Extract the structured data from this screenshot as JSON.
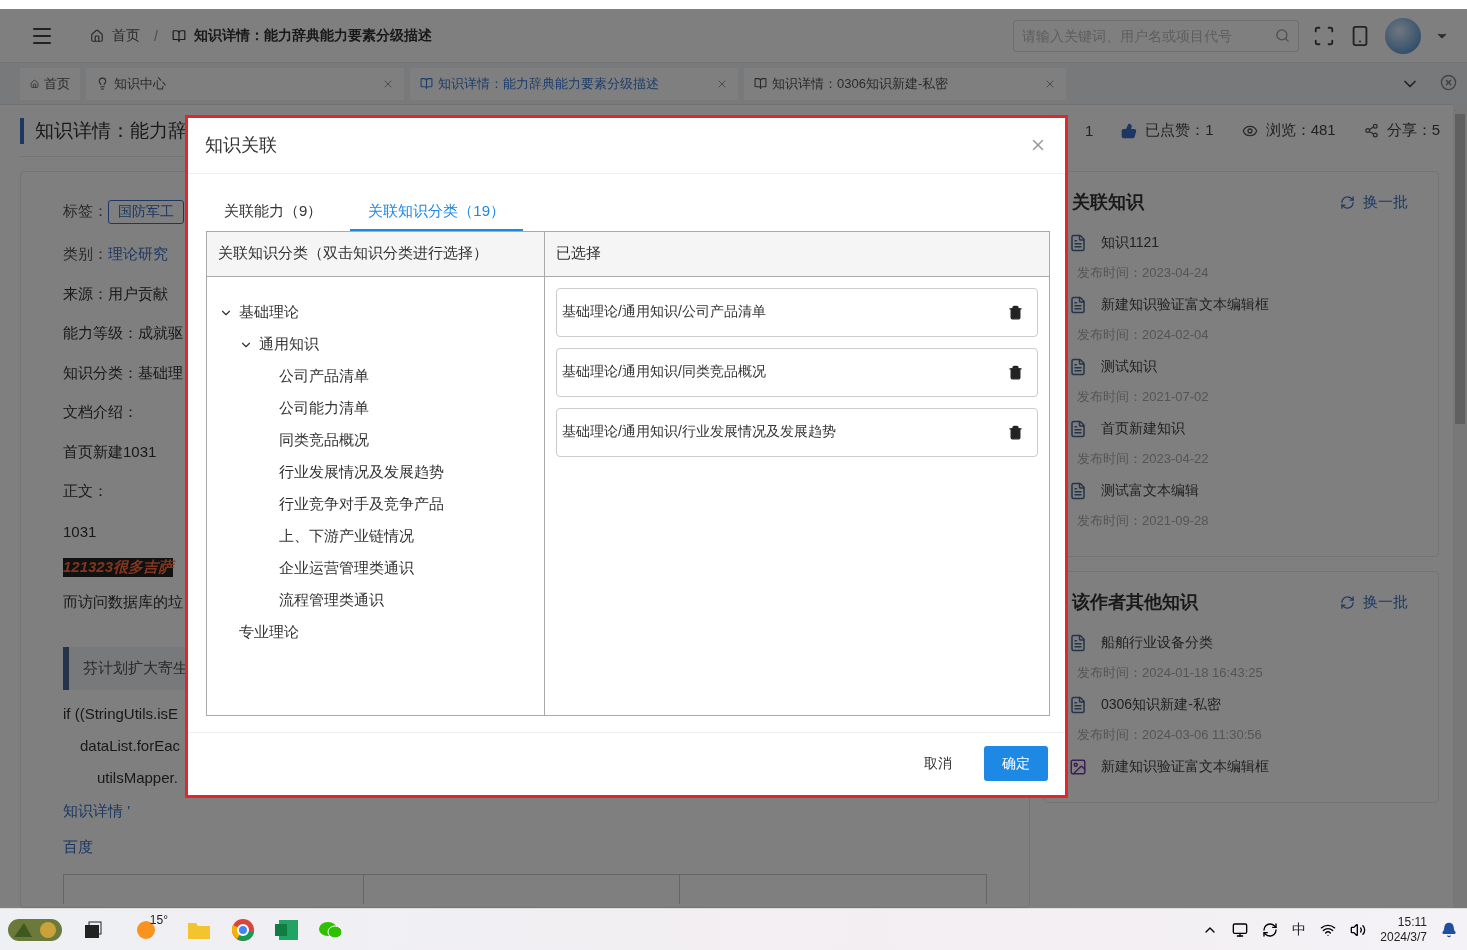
{
  "header": {
    "breadcrumb": [
      {
        "kind": "home",
        "label": "首页"
      },
      {
        "kind": "book",
        "label": "知识详情：能力辞典能力要素分级描述"
      }
    ],
    "separator": "/",
    "search": {
      "placeholder": "请输入关键词、用户名或项目代号"
    }
  },
  "tabs": [
    {
      "kind": "home",
      "label": "首页",
      "selected": false,
      "closable": false
    },
    {
      "kind": "bulb",
      "label": "知识中心",
      "selected": false,
      "closable": true
    },
    {
      "kind": "book",
      "label": "知识详情：能力辞典能力要素分级描述",
      "selected": true,
      "closable": true
    },
    {
      "kind": "book",
      "label": "知识详情：0306知识新建-私密",
      "selected": false,
      "closable": true
    }
  ],
  "page": {
    "title": "知识详情：能力辞",
    "stats": [
      {
        "kind": "count",
        "text": "1"
      },
      {
        "kind": "like",
        "text": "已点赞：1"
      },
      {
        "kind": "view",
        "text": "浏览：481"
      },
      {
        "kind": "share",
        "text": "分享：5"
      }
    ],
    "rows": [
      {
        "kind": "tags",
        "label": "标签：",
        "tags": [
          "国防军工"
        ]
      },
      {
        "kind": "link",
        "label": "类别：",
        "value": "理论研究"
      },
      {
        "kind": "text",
        "text": "来源：用户贡献"
      },
      {
        "kind": "text",
        "text": "能力等级：成就驱"
      },
      {
        "kind": "text",
        "text": "知识分类：基础理"
      },
      {
        "kind": "text",
        "text": "文档介绍："
      },
      {
        "kind": "text",
        "text": "首页新建1031"
      },
      {
        "kind": "text",
        "text": "正文："
      },
      {
        "kind": "text",
        "text": "1031"
      },
      {
        "kind": "highlight",
        "text": "121323很多吉萨"
      },
      {
        "kind": "text",
        "text": "而访问数据库的垃"
      },
      {
        "kind": "quote",
        "text": "芬计划扩大寄生"
      },
      {
        "kind": "code",
        "lines": [
          {
            "text": "if ((StringUtils.isE",
            "children": [
              {
                "text": "dataList.forEac",
                "children": [
                  {
                    "text": "utilsMapper."
                  }
                ]
              }
            ]
          }
        ]
      },
      {
        "kind": "anchor",
        "text": "知识详情 '"
      },
      {
        "kind": "anchor",
        "text": "百度"
      }
    ]
  },
  "sidebar": [
    {
      "title": "关联知识",
      "action": "换一批",
      "items": [
        {
          "kind": "doc",
          "title": "知识1121",
          "date": "发布时间：2023-04-24"
        },
        {
          "kind": "doc",
          "title": "新建知识验证富文本编辑框",
          "date": "发布时间：2024-02-04"
        },
        {
          "kind": "doc",
          "title": "测试知识",
          "date": "发布时间：2021-07-02"
        },
        {
          "kind": "doc",
          "title": "首页新建知识",
          "date": "发布时间：2023-04-22"
        },
        {
          "kind": "doc",
          "title": "测试富文本编辑",
          "date": "发布时间：2021-09-28"
        }
      ]
    },
    {
      "title": "该作者其他知识",
      "action": "换一批",
      "items": [
        {
          "kind": "doc",
          "title": "船舶行业设备分类",
          "date": "发布时间：2024-01-18 16:43:25"
        },
        {
          "kind": "doc",
          "title": "0306知识新建-私密",
          "date": "发布时间：2024-03-06 11:30:56"
        },
        {
          "kind": "image",
          "title": "新建知识验证富文本编辑框"
        }
      ]
    }
  ],
  "dialog": {
    "title": "知识关联",
    "tabs": [
      {
        "label": "关联能力（9）",
        "selected": false
      },
      {
        "label": "关联知识分类（19）",
        "selected": true
      }
    ],
    "tree_header": "关联知识分类（双击知识分类进行选择）",
    "tree": [
      {
        "label": "基础理论",
        "expanded": true,
        "children": [
          {
            "label": "通用知识",
            "expanded": true,
            "children": [
              {
                "label": "公司产品清单"
              },
              {
                "label": "公司能力清单"
              },
              {
                "label": "同类竞品概况"
              },
              {
                "label": "行业发展情况及发展趋势"
              },
              {
                "label": "行业竞争对手及竞争产品"
              },
              {
                "label": "上、下游产业链情况"
              },
              {
                "label": "企业运营管理类通识"
              },
              {
                "label": "流程管理类通识"
              }
            ]
          }
        ]
      },
      {
        "label": "专业理论"
      }
    ],
    "selected_header": "已选择",
    "selected": [
      "基础理论/通用知识/公司产品清单",
      "基础理论/通用知识/同类竞品概况",
      "基础理论/通用知识/行业发展情况及发展趋势"
    ],
    "buttons": [
      {
        "kind": "cancel",
        "label": "取消"
      },
      {
        "kind": "confirm",
        "label": "确定"
      }
    ]
  },
  "taskbar": {
    "weather": "15°",
    "ime": "中",
    "time": "15:11",
    "date": "2024/3/7"
  }
}
